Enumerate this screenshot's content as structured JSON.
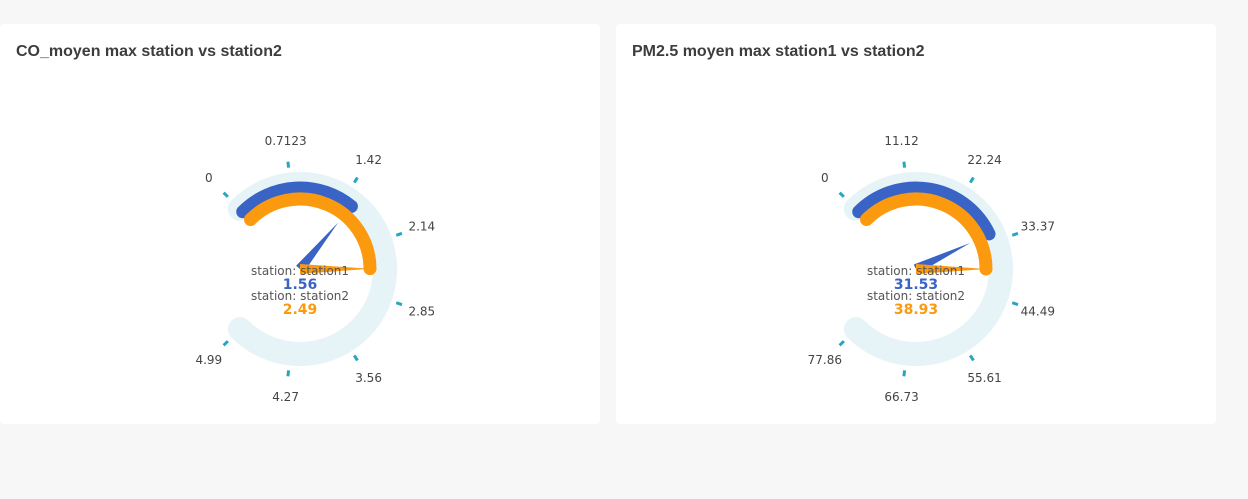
{
  "chart_data": [
    {
      "type": "gauge",
      "title": "CO_moyen max station vs station2",
      "min": 0,
      "max": 4.99,
      "tick_labels": [
        "0",
        "0.7123",
        "1.42",
        "2.14",
        "2.85",
        "3.56",
        "4.27",
        "4.99"
      ],
      "series": [
        {
          "name": "station: station1",
          "value": 1.56,
          "value_label": "1.56",
          "color": "#3a63c6"
        },
        {
          "name": "station: station2",
          "value": 2.49,
          "value_label": "2.49",
          "color": "#fb9a0e"
        }
      ],
      "track_color": "#e6f3f7",
      "tick_color": "#27a6c1"
    },
    {
      "type": "gauge",
      "title": "PM2.5 moyen max station1 vs station2",
      "min": 0,
      "max": 77.86,
      "tick_labels": [
        "0",
        "11.12",
        "22.24",
        "33.37",
        "44.49",
        "55.61",
        "66.73",
        "77.86"
      ],
      "series": [
        {
          "name": "station: station1",
          "value": 31.53,
          "value_label": "31.53",
          "color": "#3a63c6"
        },
        {
          "name": "station: station2",
          "value": 38.93,
          "value_label": "38.93",
          "color": "#fb9a0e"
        }
      ],
      "track_color": "#e6f3f7",
      "tick_color": "#27a6c1"
    }
  ]
}
